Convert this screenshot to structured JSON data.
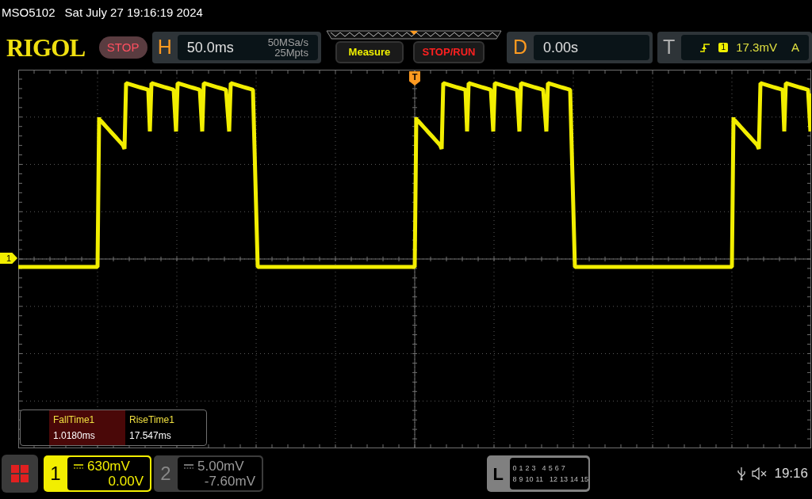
{
  "status_line": {
    "model": "MSO5102",
    "datetime": "Sat July 27 19:16:19 2024"
  },
  "logo": "RIGOL",
  "run_state": "STOP",
  "horizontal": {
    "label": "H",
    "timebase": "50.0ms",
    "sample_rate": "50MSa/s",
    "memory_depth": "25Mpts"
  },
  "buttons": [
    {
      "label": "Measure",
      "kind": "measure"
    },
    {
      "label": "STOP/RUN",
      "kind": "stoprun"
    }
  ],
  "delay": {
    "label": "D",
    "value": "0.00s"
  },
  "trigger": {
    "label": "T",
    "source": "1",
    "trigger_level": "17.3mV",
    "mode": "A"
  },
  "channel_marker": "1",
  "trigger_marker": "T",
  "measurements": [
    {
      "name": "FallTime1",
      "value": "1.0180ms",
      "selected": true
    },
    {
      "name": "RiseTime1",
      "value": "17.547ms",
      "selected": false
    }
  ],
  "channels": [
    {
      "number": "1",
      "scale": "630mV",
      "offset": "0.00V",
      "on": true
    },
    {
      "number": "2",
      "scale": "5.00mV",
      "offset": "-7.60mV",
      "on": false
    }
  ],
  "logic": {
    "label": "L",
    "row_1": [
      "0",
      "1",
      "2",
      "3",
      "4",
      "5",
      "6",
      "7"
    ],
    "row_2": [
      "8",
      "9",
      "10",
      "11",
      "12",
      "13",
      "14",
      "15"
    ]
  },
  "clock": "19:16"
}
